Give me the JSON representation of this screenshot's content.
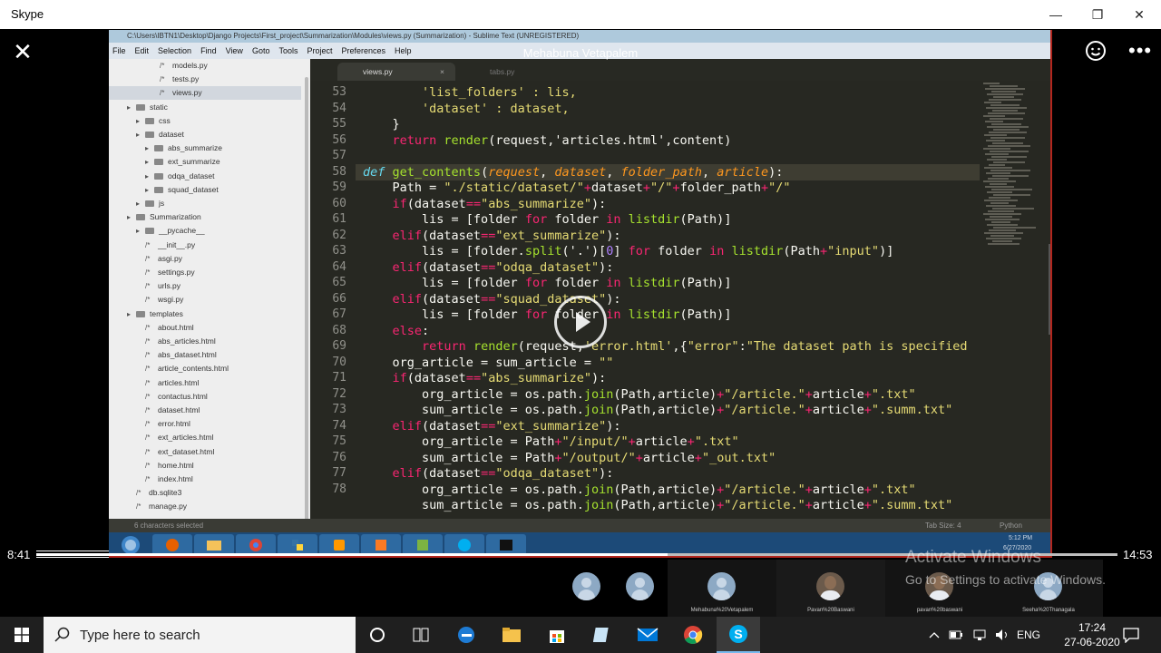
{
  "window": {
    "title": "Skype",
    "minimize": "—",
    "maximize": "❐",
    "close": "✕"
  },
  "call": {
    "caller_name": "Mehabuna Vetapalem",
    "close_icon": "✕",
    "more_icon": "•••"
  },
  "sublime": {
    "title": "C:\\Users\\IBTN1\\Desktop\\Django Projects\\First_project\\Summarization\\Modules\\views.py (Summarization) - Sublime Text (UNREGISTERED)",
    "menu": [
      "File",
      "Edit",
      "Selection",
      "Find",
      "View",
      "Goto",
      "Tools",
      "Project",
      "Preferences",
      "Help"
    ],
    "tree": [
      {
        "label": "models.py",
        "indent": 56,
        "type": "file"
      },
      {
        "label": "tests.py",
        "indent": 56,
        "type": "file"
      },
      {
        "label": "views.py",
        "indent": 56,
        "type": "file",
        "selected": true
      },
      {
        "label": "static",
        "indent": 20,
        "type": "folder"
      },
      {
        "label": "css",
        "indent": 30,
        "type": "folder"
      },
      {
        "label": "dataset",
        "indent": 30,
        "type": "folder"
      },
      {
        "label": "abs_summarize",
        "indent": 40,
        "type": "folder"
      },
      {
        "label": "ext_summarize",
        "indent": 40,
        "type": "folder"
      },
      {
        "label": "odqa_dataset",
        "indent": 40,
        "type": "folder"
      },
      {
        "label": "squad_dataset",
        "indent": 40,
        "type": "folder"
      },
      {
        "label": "js",
        "indent": 30,
        "type": "folder"
      },
      {
        "label": "Summarization",
        "indent": 20,
        "type": "folder"
      },
      {
        "label": "__pycache__",
        "indent": 30,
        "type": "folder"
      },
      {
        "label": "__init__.py",
        "indent": 40,
        "type": "file"
      },
      {
        "label": "asgi.py",
        "indent": 40,
        "type": "file"
      },
      {
        "label": "settings.py",
        "indent": 40,
        "type": "file"
      },
      {
        "label": "urls.py",
        "indent": 40,
        "type": "file"
      },
      {
        "label": "wsgi.py",
        "indent": 40,
        "type": "file"
      },
      {
        "label": "templates",
        "indent": 20,
        "type": "folder"
      },
      {
        "label": "about.html",
        "indent": 40,
        "type": "file"
      },
      {
        "label": "abs_articles.html",
        "indent": 40,
        "type": "file"
      },
      {
        "label": "abs_dataset.html",
        "indent": 40,
        "type": "file"
      },
      {
        "label": "article_contents.html",
        "indent": 40,
        "type": "file"
      },
      {
        "label": "articles.html",
        "indent": 40,
        "type": "file"
      },
      {
        "label": "contactus.html",
        "indent": 40,
        "type": "file"
      },
      {
        "label": "dataset.html",
        "indent": 40,
        "type": "file"
      },
      {
        "label": "error.html",
        "indent": 40,
        "type": "file"
      },
      {
        "label": "ext_articles.html",
        "indent": 40,
        "type": "file"
      },
      {
        "label": "ext_dataset.html",
        "indent": 40,
        "type": "file"
      },
      {
        "label": "home.html",
        "indent": 40,
        "type": "file"
      },
      {
        "label": "index.html",
        "indent": 40,
        "type": "file"
      },
      {
        "label": "db.sqlite3",
        "indent": 30,
        "type": "file"
      },
      {
        "label": "manage.py",
        "indent": 30,
        "type": "file"
      }
    ],
    "tabs": [
      {
        "label": "views.py",
        "active": true
      },
      {
        "label": "tabs.py",
        "active": false
      }
    ],
    "line_numbers": [
      "53",
      "54",
      "55",
      "56",
      "57",
      "58",
      "59",
      "60",
      "61",
      "62",
      "63",
      "64",
      "65",
      "66",
      "67",
      "68",
      "69",
      "70",
      "71",
      "72",
      "73",
      "74",
      "75",
      "76",
      "77",
      "78"
    ],
    "code": [
      [
        [
          "        'list_folders' : lis,",
          "st"
        ]
      ],
      [
        [
          "        'dataset' : dataset,",
          "st"
        ]
      ],
      [
        [
          "    }",
          ""
        ]
      ],
      [
        [
          "    ",
          "kw"
        ],
        [
          "return ",
          "kw"
        ],
        [
          "render",
          "fn"
        ],
        [
          "(request,'articles.html',content)",
          ""
        ]
      ],
      [
        [
          "",
          ""
        ]
      ],
      [
        [
          "def ",
          "df"
        ],
        [
          "get_contents",
          "fn"
        ],
        [
          "(",
          ""
        ],
        [
          "request",
          "pa"
        ],
        [
          ", ",
          ""
        ],
        [
          "dataset",
          "pa"
        ],
        [
          ", ",
          ""
        ],
        [
          "folder_path",
          "pa"
        ],
        [
          ", ",
          ""
        ],
        [
          "article",
          "pa"
        ],
        [
          "):",
          ""
        ]
      ],
      [
        [
          "    Path = ",
          ""
        ],
        [
          "\"./static/dataset/\"",
          "st"
        ],
        [
          "+",
          "kw"
        ],
        [
          "dataset",
          ""
        ],
        [
          "+",
          "kw"
        ],
        [
          "\"/\"",
          "st"
        ],
        [
          "+",
          "kw"
        ],
        [
          "folder_path",
          ""
        ],
        [
          "+",
          "kw"
        ],
        [
          "\"/\"",
          "st"
        ]
      ],
      [
        [
          "    ",
          ""
        ],
        [
          "if",
          "kw"
        ],
        [
          "(dataset",
          ""
        ],
        [
          "==",
          "kw"
        ],
        [
          "\"abs_summarize\"",
          "st"
        ],
        [
          "):",
          ""
        ]
      ],
      [
        [
          "        lis = [folder ",
          ""
        ],
        [
          "for",
          "kw"
        ],
        [
          " folder ",
          ""
        ],
        [
          "in",
          "kw"
        ],
        [
          " ",
          ""
        ],
        [
          "listdir",
          "fn"
        ],
        [
          "(Path)]",
          ""
        ]
      ],
      [
        [
          "    ",
          ""
        ],
        [
          "elif",
          "kw"
        ],
        [
          "(dataset",
          ""
        ],
        [
          "==",
          "kw"
        ],
        [
          "\"ext_summarize\"",
          "st"
        ],
        [
          "):",
          ""
        ]
      ],
      [
        [
          "        lis = [folder.",
          ""
        ],
        [
          "split",
          "fn"
        ],
        [
          "('.')[",
          ""
        ],
        [
          "0",
          "nm"
        ],
        [
          "] ",
          ""
        ],
        [
          "for",
          "kw"
        ],
        [
          " folder ",
          ""
        ],
        [
          "in",
          "kw"
        ],
        [
          " ",
          ""
        ],
        [
          "listdir",
          "fn"
        ],
        [
          "(Path",
          ""
        ],
        [
          "+",
          "kw"
        ],
        [
          "\"input\"",
          "st"
        ],
        [
          ")]",
          ""
        ]
      ],
      [
        [
          "    ",
          ""
        ],
        [
          "elif",
          "kw"
        ],
        [
          "(dataset",
          ""
        ],
        [
          "==",
          "kw"
        ],
        [
          "\"odqa_dataset\"",
          "st"
        ],
        [
          "):",
          ""
        ]
      ],
      [
        [
          "        lis = [folder ",
          ""
        ],
        [
          "for",
          "kw"
        ],
        [
          " folder ",
          ""
        ],
        [
          "in",
          "kw"
        ],
        [
          " ",
          ""
        ],
        [
          "listdir",
          "fn"
        ],
        [
          "(Path)]",
          ""
        ]
      ],
      [
        [
          "    ",
          ""
        ],
        [
          "elif",
          "kw"
        ],
        [
          "(dataset",
          ""
        ],
        [
          "==",
          "kw"
        ],
        [
          "\"squad_dataset\"",
          "st"
        ],
        [
          "):",
          ""
        ]
      ],
      [
        [
          "        lis = [folder ",
          ""
        ],
        [
          "for",
          "kw"
        ],
        [
          " folder ",
          ""
        ],
        [
          "in",
          "kw"
        ],
        [
          " ",
          ""
        ],
        [
          "listdir",
          "fn"
        ],
        [
          "(Path)]",
          ""
        ]
      ],
      [
        [
          "    ",
          ""
        ],
        [
          "else",
          "kw"
        ],
        [
          ":",
          ""
        ]
      ],
      [
        [
          "        ",
          ""
        ],
        [
          "return ",
          "kw"
        ],
        [
          "render",
          "fn"
        ],
        [
          "(request,",
          ""
        ],
        [
          "'error.html'",
          "st"
        ],
        [
          ",{",
          ""
        ],
        [
          "\"error\"",
          "st"
        ],
        [
          ":",
          ""
        ],
        [
          "\"The dataset path is specified",
          "st"
        ]
      ],
      [
        [
          "    org_article = sum_article = ",
          ""
        ],
        [
          "\"\"",
          "st"
        ]
      ],
      [
        [
          "    ",
          ""
        ],
        [
          "if",
          "kw"
        ],
        [
          "(dataset",
          ""
        ],
        [
          "==",
          "kw"
        ],
        [
          "\"abs_summarize\"",
          "st"
        ],
        [
          "):",
          ""
        ]
      ],
      [
        [
          "        org_article = os.path.",
          ""
        ],
        [
          "join",
          "fn"
        ],
        [
          "(Path,article)",
          ""
        ],
        [
          "+",
          "kw"
        ],
        [
          "\"/article.\"",
          "st"
        ],
        [
          "+",
          "kw"
        ],
        [
          "article",
          ""
        ],
        [
          "+",
          "kw"
        ],
        [
          "\".txt\"",
          "st"
        ]
      ],
      [
        [
          "        sum_article = os.path.",
          ""
        ],
        [
          "join",
          "fn"
        ],
        [
          "(Path,article)",
          ""
        ],
        [
          "+",
          "kw"
        ],
        [
          "\"/article.\"",
          "st"
        ],
        [
          "+",
          "kw"
        ],
        [
          "article",
          ""
        ],
        [
          "+",
          "kw"
        ],
        [
          "\".summ.txt\"",
          "st"
        ]
      ],
      [
        [
          "    ",
          ""
        ],
        [
          "elif",
          "kw"
        ],
        [
          "(dataset",
          ""
        ],
        [
          "==",
          "kw"
        ],
        [
          "\"ext_summarize\"",
          "st"
        ],
        [
          "):",
          ""
        ]
      ],
      [
        [
          "        org_article = Path",
          ""
        ],
        [
          "+",
          "kw"
        ],
        [
          "\"/input/\"",
          "st"
        ],
        [
          "+",
          "kw"
        ],
        [
          "article",
          ""
        ],
        [
          "+",
          "kw"
        ],
        [
          "\".txt\"",
          "st"
        ]
      ],
      [
        [
          "        sum_article = Path",
          ""
        ],
        [
          "+",
          "kw"
        ],
        [
          "\"/output/\"",
          "st"
        ],
        [
          "+",
          "kw"
        ],
        [
          "article",
          ""
        ],
        [
          "+",
          "kw"
        ],
        [
          "\"_out.txt\"",
          "st"
        ]
      ],
      [
        [
          "    ",
          ""
        ],
        [
          "elif",
          "kw"
        ],
        [
          "(dataset",
          ""
        ],
        [
          "==",
          "kw"
        ],
        [
          "\"odqa_dataset\"",
          "st"
        ],
        [
          "):",
          ""
        ]
      ],
      [
        [
          "        org_article = os.path.",
          ""
        ],
        [
          "join",
          "fn"
        ],
        [
          "(Path,article)",
          ""
        ],
        [
          "+",
          "kw"
        ],
        [
          "\"/article.\"",
          "st"
        ],
        [
          "+",
          "kw"
        ],
        [
          "article",
          ""
        ],
        [
          "+",
          "kw"
        ],
        [
          "\".txt\"",
          "st"
        ]
      ],
      [
        [
          "        sum_article = os.path.",
          ""
        ],
        [
          "join",
          "fn"
        ],
        [
          "(Path,article)",
          ""
        ],
        [
          "+",
          "kw"
        ],
        [
          "\"/article.\"",
          "st"
        ],
        [
          "+",
          "kw"
        ],
        [
          "article",
          ""
        ],
        [
          "+",
          "kw"
        ],
        [
          "\".summ.txt\"",
          "st"
        ]
      ]
    ],
    "status_left": "6 characters selected",
    "status_tab": "Tab Size: 4",
    "status_syntax": "Python",
    "win7_clock_time": "5:12 PM",
    "win7_clock_date": "6/27/2020"
  },
  "playback": {
    "elapsed": "8:41",
    "total": "14:53",
    "progress_fraction": 0.584
  },
  "participants": [
    {
      "name": "",
      "photo": false
    },
    {
      "name": "",
      "photo": false
    },
    {
      "name": "Mehabuna%20Vetapalem",
      "photo": false
    },
    {
      "name": "Pavan%20Baswani",
      "photo": true
    },
    {
      "name": "pavan%20baswani",
      "photo": true
    },
    {
      "name": "Seeha%20Thanagala",
      "photo": false
    }
  ],
  "watermark": {
    "line1": "Activate Windows",
    "line2": "Go to Settings to activate Windows."
  },
  "taskbar": {
    "search_placeholder": "Type here to search",
    "language": "ENG",
    "time": "17:24",
    "date": "27-06-2020"
  },
  "colors": {
    "accent_red": "#b3261e",
    "skype_blue": "#00aff0",
    "editor_bg": "#272822"
  }
}
